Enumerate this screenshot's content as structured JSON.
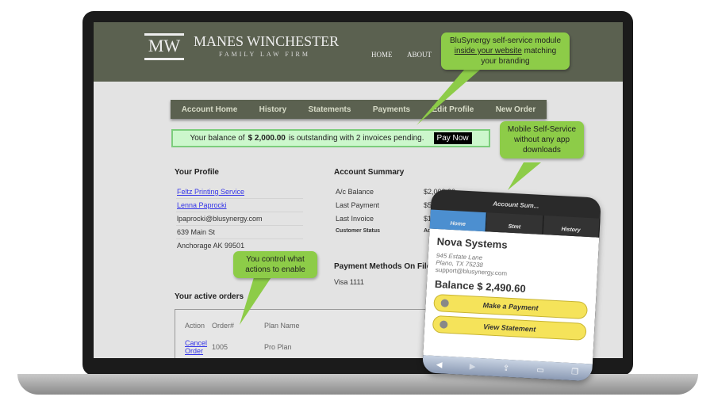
{
  "site": {
    "logo_text": "MW",
    "firm_name": "MANES WINCHESTER",
    "firm_sub": "FAMILY LAW FIRM",
    "top_nav": [
      "HOME",
      "ABOUT"
    ]
  },
  "nav": [
    "Account Home",
    "History",
    "Statements",
    "Payments",
    "Edit Profile",
    "New Order"
  ],
  "balance": {
    "prefix": "Your balance of",
    "amount": "$ 2,000.00",
    "suffix": "is outstanding with 2 invoices pending.",
    "pay_label": "Pay Now"
  },
  "profile": {
    "title": "Your Profile",
    "company": "Feltz Printing Service",
    "name": "Lenna Paprocki",
    "email": "lpaprocki@blusynergy.com",
    "street": "639 Main St",
    "city": "Anchorage AK 99501"
  },
  "summary": {
    "title": "Account Summary",
    "rows": [
      [
        "A/c Balance",
        "$2,000.00"
      ],
      [
        "Last Payment",
        "$500.00 on 5/"
      ],
      [
        "Last Invoice",
        "$1,500.00 o"
      ],
      [
        "Customer Status",
        "Active"
      ]
    ]
  },
  "payment_methods": {
    "title": "Payment Methods On File",
    "card": "Visa 1111",
    "link": "R"
  },
  "orders": {
    "title": "Your active orders",
    "headers": [
      "Action",
      "Order#",
      "Plan Name"
    ],
    "rows": [
      {
        "action": "Cancel Order",
        "order": "1005",
        "plan": "Pro Plan"
      }
    ]
  },
  "callouts": {
    "branding": [
      "BluSynergy self-service module",
      "inside your website",
      " matching",
      "your branding"
    ],
    "mobile": "Mobile Self-Service without any app downloads",
    "control": "You control what actions to enable"
  },
  "phone": {
    "title": "Account Sum...",
    "tabs": [
      "Home",
      "Stmt",
      "History"
    ],
    "company": "Nova Systems",
    "address1": "945 Estate Lane",
    "address2": "Plano, TX 75238",
    "email": "support@blusynergy.com",
    "balance": "Balance $ 2,490.60",
    "buttons": [
      "Make a Payment",
      "View Statement"
    ]
  },
  "colors": {
    "header": "#5b6150",
    "callout": "#8dcc48",
    "balance_bg": "#ccf7cc",
    "phone_button": "#f5e35a",
    "phone_tab_active": "#4c8fd0"
  }
}
